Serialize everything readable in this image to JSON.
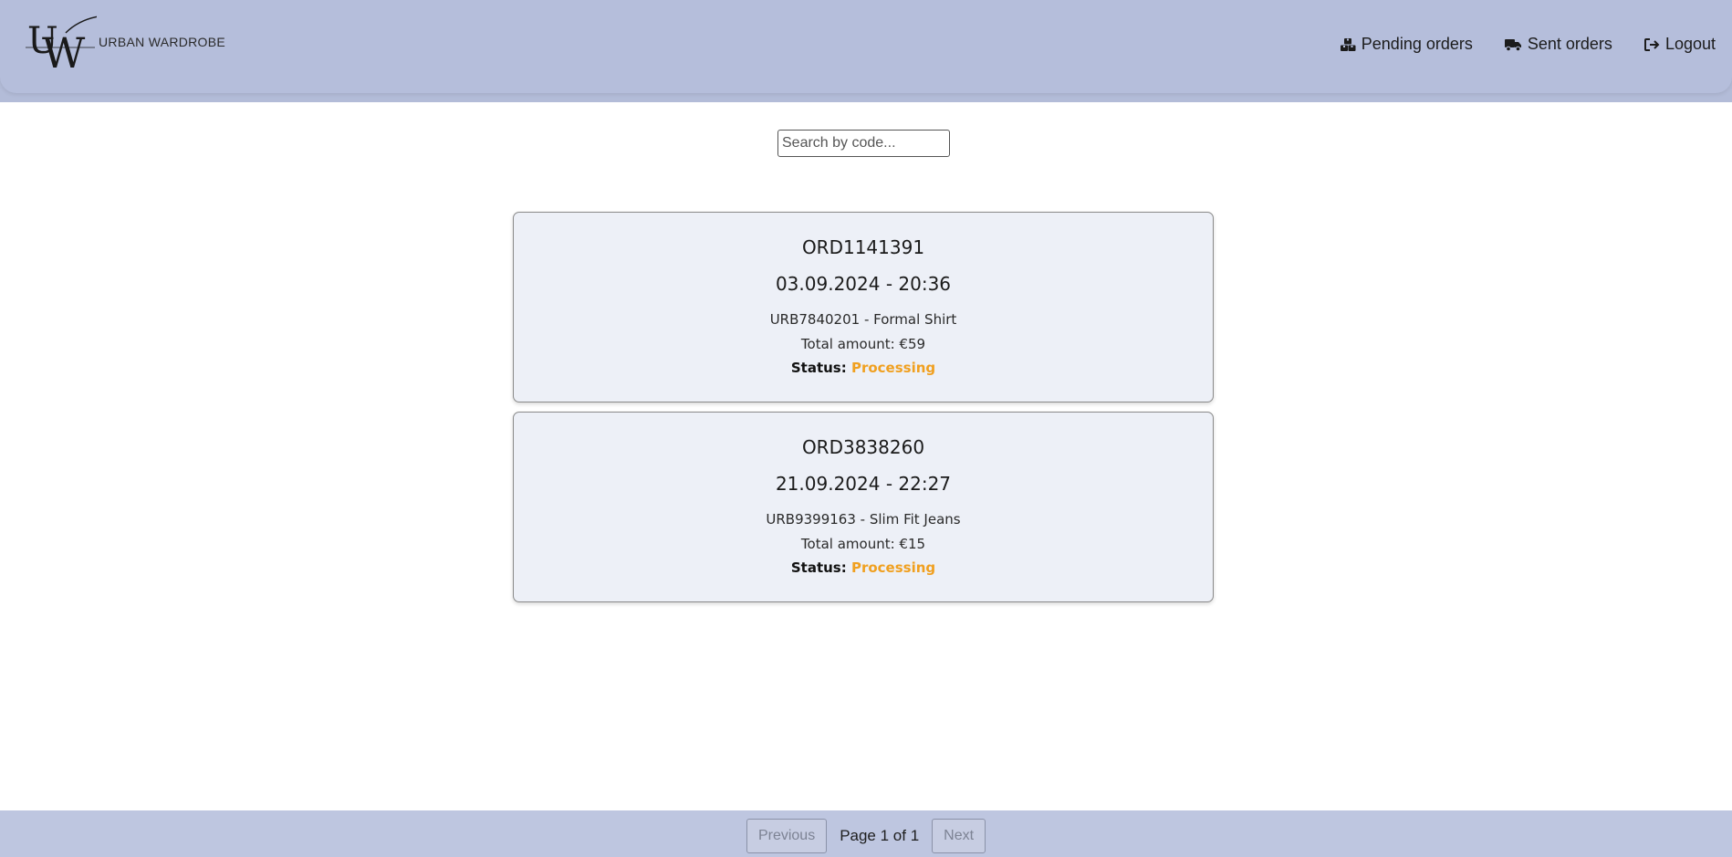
{
  "header": {
    "logo_text": "URBAN WARDROBE",
    "nav": [
      {
        "label": "Pending orders",
        "icon": "boxes-icon"
      },
      {
        "label": "Sent orders",
        "icon": "truck-icon"
      },
      {
        "label": "Logout",
        "icon": "logout-icon"
      }
    ]
  },
  "search": {
    "placeholder": "Search by code..."
  },
  "orders": [
    {
      "code": "ORD1141391",
      "date": "03.09.2024 - 20:36",
      "item": "URB7840201 - Formal Shirt",
      "total": "Total amount: €59",
      "status_label": "Status:",
      "status_value": "Processing"
    },
    {
      "code": "ORD3838260",
      "date": "21.09.2024 - 22:27",
      "item": "URB9399163 - Slim Fit Jeans",
      "total": "Total amount: €15",
      "status_label": "Status:",
      "status_value": "Processing"
    }
  ],
  "pagination": {
    "previous_label": "Previous",
    "page_label": "Page 1 of 1",
    "next_label": "Next"
  },
  "colors": {
    "header_bg": "#b5bedb",
    "card_bg": "#edf0f7",
    "status_processing": "#f0a020",
    "footer_bg": "#bec6e0"
  }
}
